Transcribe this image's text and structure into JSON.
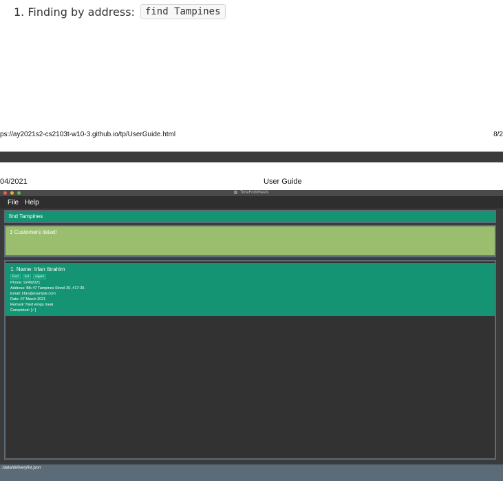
{
  "doc": {
    "step_label": "1. Finding by address:",
    "step_code": "find Tampines",
    "print_url": "ps://ay2021s2-cs2103t-w10-3.github.io/tp/UserGuide.html",
    "print_page": "8/2",
    "print_date": "04/2021",
    "print_title": "User Guide"
  },
  "app": {
    "window_title": "TimeForWheels",
    "menu": [
      "File",
      "Help"
    ],
    "command_input": "find Tampines",
    "result_message": "1 Customers listed!",
    "customers": [
      {
        "index": "1.",
        "name": "Name: Irfan Ibrahim",
        "tags": [
          "food",
          "hot",
          "urgent"
        ],
        "phone": "Phone: 92492021",
        "address": "Address: Blk 47 Tampines Street 20, #17-35",
        "email": "Email: irfan@example.com",
        "date": "Date: 07 March 2021",
        "remark": "Remark: fried wings meal",
        "completed": "Completed: [✓]"
      }
    ],
    "status_path": "./data/deliverylist.json"
  },
  "colors": {
    "accent_green": "#159474",
    "result_green": "#9bbd6e",
    "panel_bg": "#323232",
    "status_bar": "#5b6b78"
  }
}
